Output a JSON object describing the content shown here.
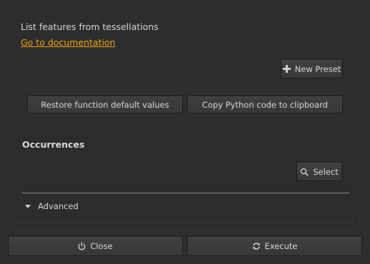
{
  "description": "List features from tessellations",
  "doc_link": "Go to documentation",
  "presets": {
    "new_preset_label": "New Preset",
    "new_preset_icon": "plus-icon"
  },
  "actions": {
    "restore_label": "Restore function default values",
    "copy_label": "Copy Python code to clipboard"
  },
  "occurrences": {
    "title": "Occurrences",
    "select_label": "Select",
    "select_icon": "search-icon",
    "advanced_label": "Advanced"
  },
  "footer": {
    "close_label": "Close",
    "close_icon": "power-icon",
    "execute_label": "Execute",
    "execute_icon": "refresh-icon"
  },
  "colors": {
    "link": "#f0a30a",
    "background": "#2d2d2d"
  }
}
